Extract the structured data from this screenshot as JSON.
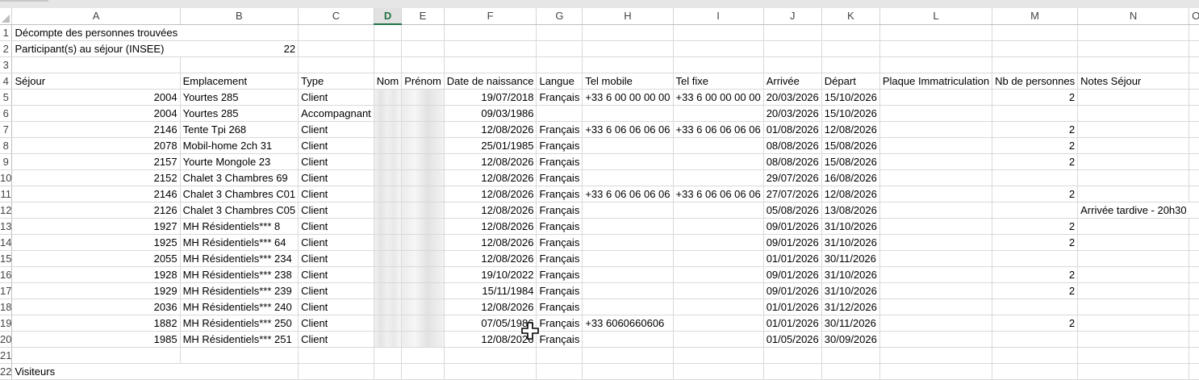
{
  "columns": [
    "A",
    "B",
    "C",
    "D",
    "E",
    "F",
    "G",
    "H",
    "I",
    "J",
    "K",
    "L",
    "M",
    "N",
    "O"
  ],
  "rows": [
    {
      "n": "1",
      "a": "Décompte des personnes trouvées",
      "b": "",
      "c": "",
      "f": "",
      "g": "",
      "h": "",
      "i": "",
      "j": "",
      "k": "",
      "l": "",
      "m": "",
      "nn": ""
    },
    {
      "n": "2",
      "a": "Participant(s) au séjour (INSEE)",
      "b": "22",
      "c": "",
      "f": "",
      "g": "",
      "h": "",
      "i": "",
      "j": "",
      "k": "",
      "l": "",
      "m": "",
      "nn": ""
    },
    {
      "n": "3",
      "a": "",
      "b": "",
      "c": "",
      "f": "",
      "g": "",
      "h": "",
      "i": "",
      "j": "",
      "k": "",
      "l": "",
      "m": "",
      "nn": ""
    },
    {
      "n": "4",
      "a": "Séjour",
      "b": "Emplacement",
      "c": "Type",
      "d": "Nom",
      "e": "Prénom",
      "f": "Date de naissance",
      "g": "Langue",
      "h": "Tel mobile",
      "i": "Tel fixe",
      "j": "Arrivée",
      "k": "Départ",
      "l": "Plaque Immatriculation",
      "m": "Nb de personnes",
      "nn": "Notes Séjour"
    },
    {
      "n": "5",
      "a": "2004",
      "b": "Yourtes 285",
      "c": "Client",
      "f": "19/07/2018",
      "g": "Français",
      "h": "+33 6 00 00 00 00",
      "i": "+33 6 00 00 00 00",
      "j": "20/03/2026",
      "k": "15/10/2026",
      "l": "",
      "m": "2",
      "nn": ""
    },
    {
      "n": "6",
      "a": "2004",
      "b": "Yourtes 285",
      "c": "Accompagnant",
      "f": "09/03/1986",
      "g": "",
      "h": "",
      "i": "",
      "j": "20/03/2026",
      "k": "15/10/2026",
      "l": "",
      "m": "",
      "nn": ""
    },
    {
      "n": "7",
      "a": "2146",
      "b": "Tente Tpi 268",
      "c": "Client",
      "f": "12/08/2026",
      "g": "Français",
      "h": "+33 6 06 06 06 06",
      "i": "+33 6 06 06 06 06",
      "j": "01/08/2026",
      "k": "12/08/2026",
      "l": "",
      "m": "2",
      "nn": ""
    },
    {
      "n": "8",
      "a": "2078",
      "b": "Mobil-home 2ch 31",
      "c": "Client",
      "f": "25/01/1985",
      "g": "Français",
      "h": "",
      "i": "",
      "j": "08/08/2026",
      "k": "15/08/2026",
      "l": "",
      "m": "2",
      "nn": ""
    },
    {
      "n": "9",
      "a": "2157",
      "b": "Yourte Mongole 23",
      "c": "Client",
      "f": "12/08/2026",
      "g": "Français",
      "h": "",
      "i": "",
      "j": "08/08/2026",
      "k": "15/08/2026",
      "l": "",
      "m": "2",
      "nn": ""
    },
    {
      "n": "10",
      "a": "2152",
      "b": "Chalet 3 Chambres 69",
      "c": "Client",
      "f": "12/08/2026",
      "g": "Français",
      "h": "",
      "i": "",
      "j": "29/07/2026",
      "k": "16/08/2026",
      "l": "",
      "m": "",
      "nn": ""
    },
    {
      "n": "11",
      "a": "2146",
      "b": "Chalet 3 Chambres C01",
      "c": "Client",
      "f": "12/08/2026",
      "g": "Français",
      "h": "+33 6 06 06 06 06",
      "i": "+33 6 06 06 06 06",
      "j": "27/07/2026",
      "k": "12/08/2026",
      "l": "",
      "m": "2",
      "nn": ""
    },
    {
      "n": "12",
      "a": "2126",
      "b": "Chalet 3 Chambres C05",
      "c": "Client",
      "f": "12/08/2026",
      "g": "Français",
      "h": "",
      "i": "",
      "j": "05/08/2026",
      "k": "13/08/2026",
      "l": "",
      "m": "",
      "nn": "Arrivée tardive - 20h30"
    },
    {
      "n": "13",
      "a": "1927",
      "b": "MH Résidentiels*** 8",
      "c": "Client",
      "f": "12/08/2026",
      "g": "Français",
      "h": "",
      "i": "",
      "j": "09/01/2026",
      "k": "31/10/2026",
      "l": "",
      "m": "2",
      "nn": ""
    },
    {
      "n": "14",
      "a": "1925",
      "b": "MH Résidentiels*** 64",
      "c": "Client",
      "f": "12/08/2026",
      "g": "Français",
      "h": "",
      "i": "",
      "j": "09/01/2026",
      "k": "31/10/2026",
      "l": "",
      "m": "2",
      "nn": ""
    },
    {
      "n": "15",
      "a": "2055",
      "b": "MH Résidentiels*** 234",
      "c": "Client",
      "f": "12/08/2026",
      "g": "Français",
      "h": "",
      "i": "",
      "j": "01/01/2026",
      "k": "30/11/2026",
      "l": "",
      "m": "",
      "nn": ""
    },
    {
      "n": "16",
      "a": "1928",
      "b": "MH Résidentiels*** 238",
      "c": "Client",
      "f": "19/10/2022",
      "g": "Français",
      "h": "",
      "i": "",
      "j": "09/01/2026",
      "k": "31/10/2026",
      "l": "",
      "m": "2",
      "nn": ""
    },
    {
      "n": "17",
      "a": "1929",
      "b": "MH Résidentiels*** 239",
      "c": "Client",
      "f": "15/11/1984",
      "g": "Français",
      "h": "",
      "i": "",
      "j": "09/01/2026",
      "k": "31/10/2026",
      "l": "",
      "m": "2",
      "nn": ""
    },
    {
      "n": "18",
      "a": "2036",
      "b": "MH Résidentiels*** 240",
      "c": "Client",
      "f": "12/08/2026",
      "g": "Français",
      "h": "",
      "i": "",
      "j": "01/01/2026",
      "k": "31/12/2026",
      "l": "",
      "m": "",
      "nn": ""
    },
    {
      "n": "19",
      "a": "1882",
      "b": "MH Résidentiels*** 250",
      "c": "Client",
      "f": "07/05/1986",
      "g": "Français",
      "h": "+33 6060660606",
      "i": "",
      "j": "01/01/2026",
      "k": "30/11/2026",
      "l": "",
      "m": "2",
      "nn": ""
    },
    {
      "n": "20",
      "a": "1985",
      "b": "MH Résidentiels*** 251",
      "c": "Client",
      "f": "12/08/2026",
      "g": "Français",
      "h": "",
      "i": "",
      "j": "01/05/2026",
      "k": "30/09/2026",
      "l": "",
      "m": "",
      "nn": ""
    },
    {
      "n": "21",
      "a": "",
      "b": "",
      "c": "",
      "f": "",
      "g": "",
      "h": "",
      "i": "",
      "j": "",
      "k": "",
      "l": "",
      "m": "",
      "nn": ""
    },
    {
      "n": "22",
      "a": "Visiteurs",
      "b": "",
      "c": "",
      "f": "",
      "g": "",
      "h": "",
      "i": "",
      "j": "",
      "k": "",
      "l": "",
      "m": "",
      "nn": ""
    }
  ],
  "selected_column": "D",
  "cursor_icon": "move-cross-cursor-icon"
}
